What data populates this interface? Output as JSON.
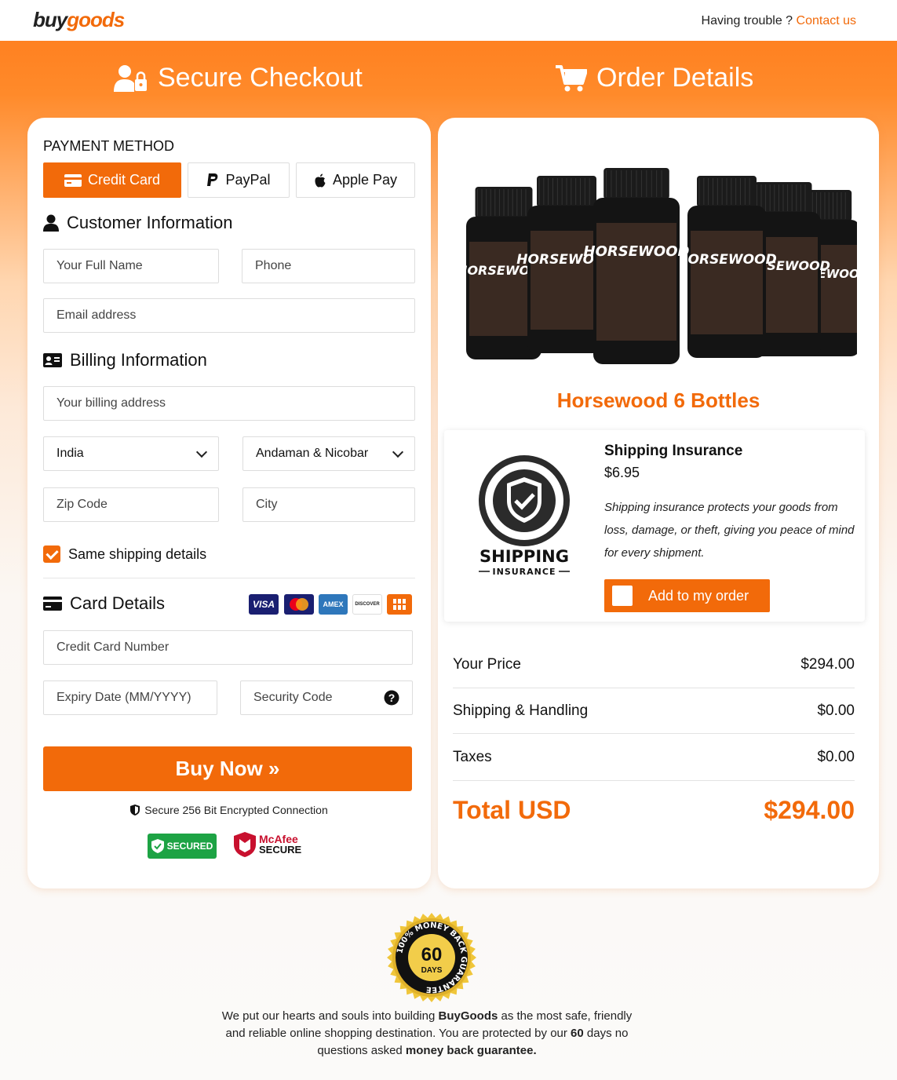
{
  "topbar": {
    "logo_part1": "buy",
    "logo_part2": "goods",
    "trouble_text": "Having trouble ? ",
    "contact_label": "Contact us"
  },
  "headers": {
    "left": "Secure Checkout",
    "right": "Order Details"
  },
  "payment": {
    "title": "PAYMENT METHOD",
    "options": [
      "Credit Card",
      "PayPal",
      "Apple Pay"
    ],
    "selected": "Credit Card"
  },
  "customer": {
    "title": "Customer Information",
    "full_name_placeholder": "Your Full Name",
    "phone_placeholder": "Phone",
    "email_placeholder": "Email address"
  },
  "billing": {
    "title": "Billing Information",
    "address_placeholder": "Your billing address",
    "country": "India",
    "state": "Andaman & Nicobar",
    "zip_placeholder": "Zip Code",
    "city_placeholder": "City",
    "same_shipping_label": "Same shipping details",
    "same_shipping_checked": true
  },
  "card": {
    "title": "Card Details",
    "brands": [
      "VISA",
      "Mastercard",
      "AMEX",
      "DISCOVER",
      "other-card-icon"
    ],
    "number_placeholder": "Credit Card Number",
    "expiry_placeholder": "Expiry Date (MM/YYYY)",
    "cvv_placeholder": "Security Code"
  },
  "buy_button": "Buy Now »",
  "secure_note": "Secure 256 Bit Encrypted Connection",
  "badges": {
    "secured": "SECURED",
    "mcafee_line1": "McAfee",
    "mcafee_line2": "SECURE"
  },
  "product": {
    "name": "Horsewood 6 Bottles",
    "bottle_label": "HORSEWOOD"
  },
  "insurance": {
    "title": "Shipping Insurance",
    "price": "$6.95",
    "description": "Shipping insurance protects your goods from loss, damage, or theft, giving you peace of mind for every shipment.",
    "add_label": "Add to my order",
    "logo_text_top": "SHIPPING",
    "logo_text_bottom": "INSURANCE"
  },
  "summary": {
    "rows": [
      {
        "label": "Your Price",
        "value": "$294.00"
      },
      {
        "label": "Shipping & Handling",
        "value": "$0.00"
      },
      {
        "label": "Taxes",
        "value": "$0.00"
      }
    ],
    "total_label": "Total USD",
    "total_value": "$294.00"
  },
  "guarantee": {
    "seal_days": "60",
    "seal_days_label": "DAYS",
    "seal_ring": "100% MONEY BACK GUARANTEE",
    "text_1": "We put our hearts and souls into building ",
    "brand": "BuyGoods",
    "text_2": " as the most safe, friendly and reliable online shopping destination. You are protected by our ",
    "days": "60",
    "text_3": " days no questions asked ",
    "emphasis": "money back guarantee."
  },
  "colors": {
    "accent": "#f26a0a",
    "secured_green": "#1da344",
    "mcafee_red": "#c8102e"
  }
}
